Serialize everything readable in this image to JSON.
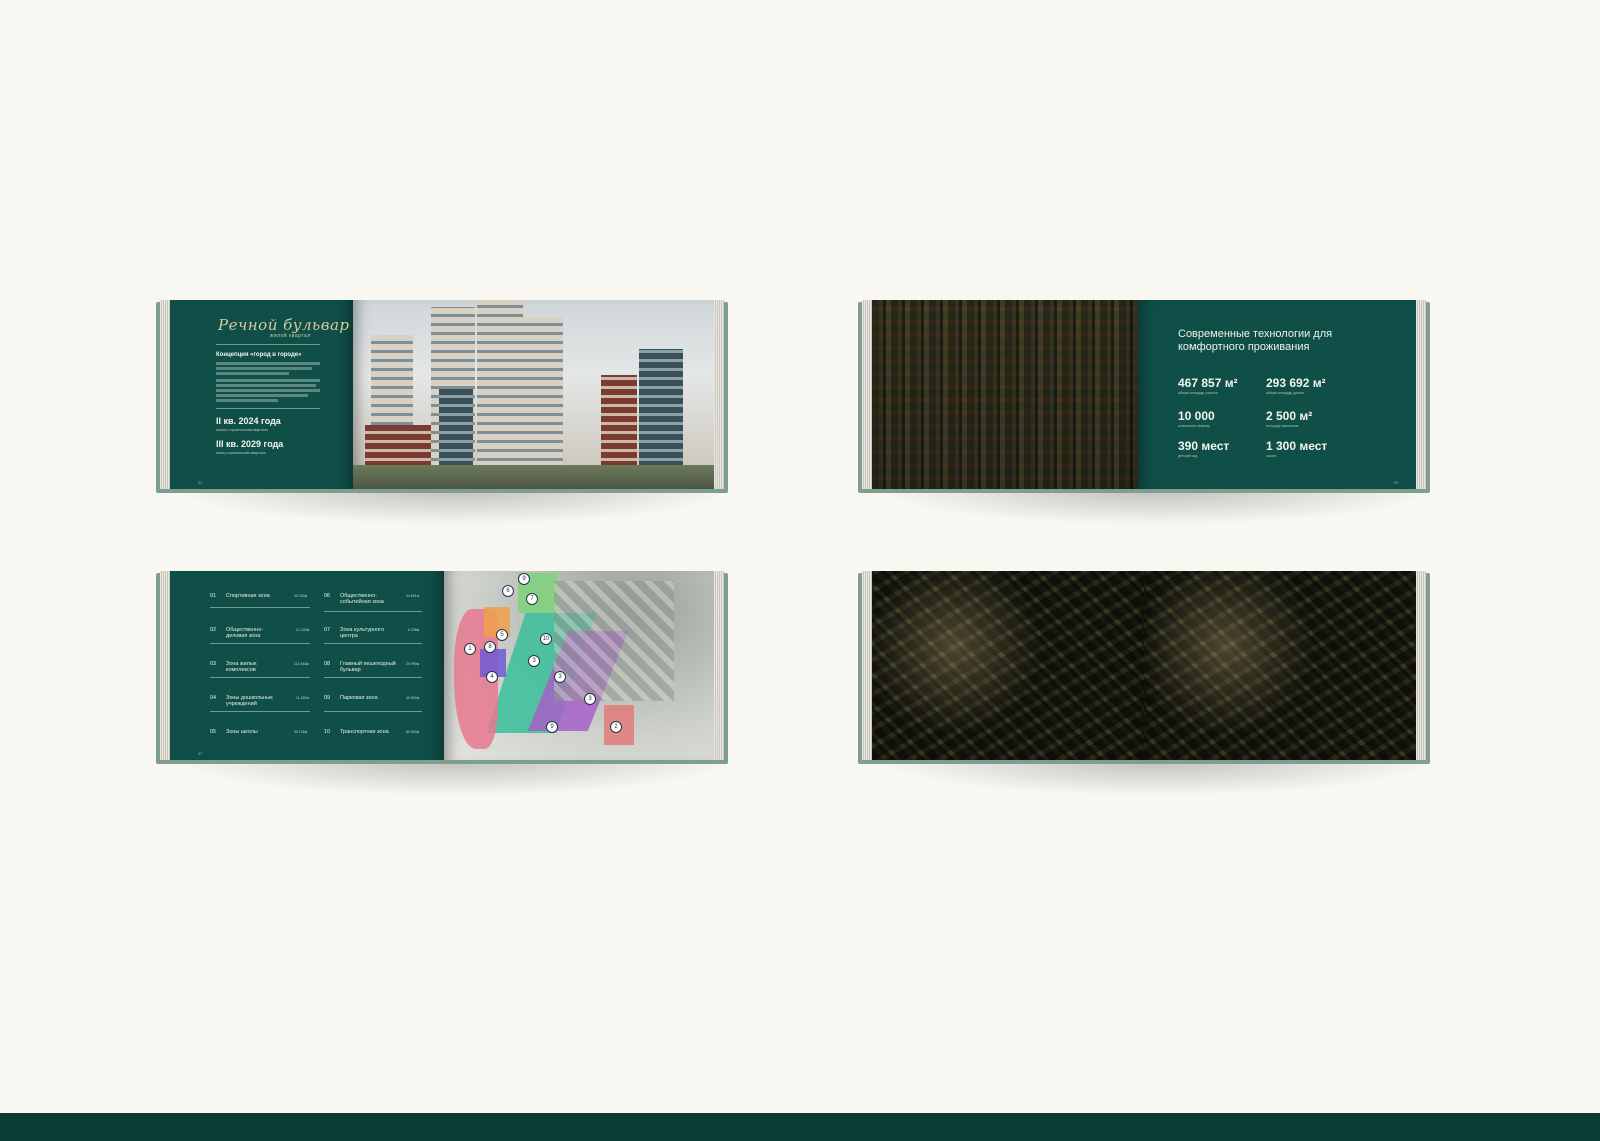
{
  "colors": {
    "background": "#f8f7f2",
    "brand_green": "#0f4f47",
    "band": "#0b3b35",
    "gold": "#d8c99e"
  },
  "book1": {
    "logo": "Речной бульвар",
    "logo_sub": "жилой квартал",
    "concept_title": "Концепция «город в городе»",
    "date1": "II кв. 2024 года",
    "date1_caption": "начало строительства квартала",
    "date2": "III кв. 2029 года",
    "date2_caption": "конец строительства квартала",
    "page_number": "02"
  },
  "book2": {
    "title": "Современные технологии для комфортного проживания",
    "stats": [
      {
        "value": "467 857 м²",
        "caption": "общая площадь участка"
      },
      {
        "value": "293 692 м²",
        "caption": "общая площадь домов"
      },
      {
        "value": "10 000",
        "caption": "количество квартир"
      },
      {
        "value": "2 500 м²",
        "caption": "площадь магазинов"
      },
      {
        "value": "390 мест",
        "caption": "детский сад"
      },
      {
        "value": "1 300 мест",
        "caption": "школа"
      }
    ],
    "page_number": "05"
  },
  "book3": {
    "zones": [
      {
        "num": "01",
        "label": "Спортивная зона",
        "value": "20 234м"
      },
      {
        "num": "02",
        "label": "Общественно-деловая зона",
        "value": "21 105м"
      },
      {
        "num": "03",
        "label": "Зона жилых комплексов",
        "value": "113 448м"
      },
      {
        "num": "04",
        "label": "Зоны дошкольных учреждений",
        "value": "11 150м"
      },
      {
        "num": "05",
        "label": "Зоны школы",
        "value": "30 136м"
      },
      {
        "num": "06",
        "label": "Общественно-событийная зона",
        "value": "24 691м"
      },
      {
        "num": "07",
        "label": "Зона культурного центра",
        "value": "6 238м"
      },
      {
        "num": "08",
        "label": "Главный пешеходный бульвар",
        "value": "20 990м"
      },
      {
        "num": "09",
        "label": "Парковая зона",
        "value": "49 840м"
      },
      {
        "num": "10",
        "label": "Транспортная зона",
        "value": "60 543м"
      }
    ],
    "pins": [
      "1",
      "2",
      "3",
      "3",
      "3",
      "4",
      "5",
      "6",
      "7",
      "8",
      "9",
      "9",
      "10"
    ],
    "page_number": "07"
  }
}
